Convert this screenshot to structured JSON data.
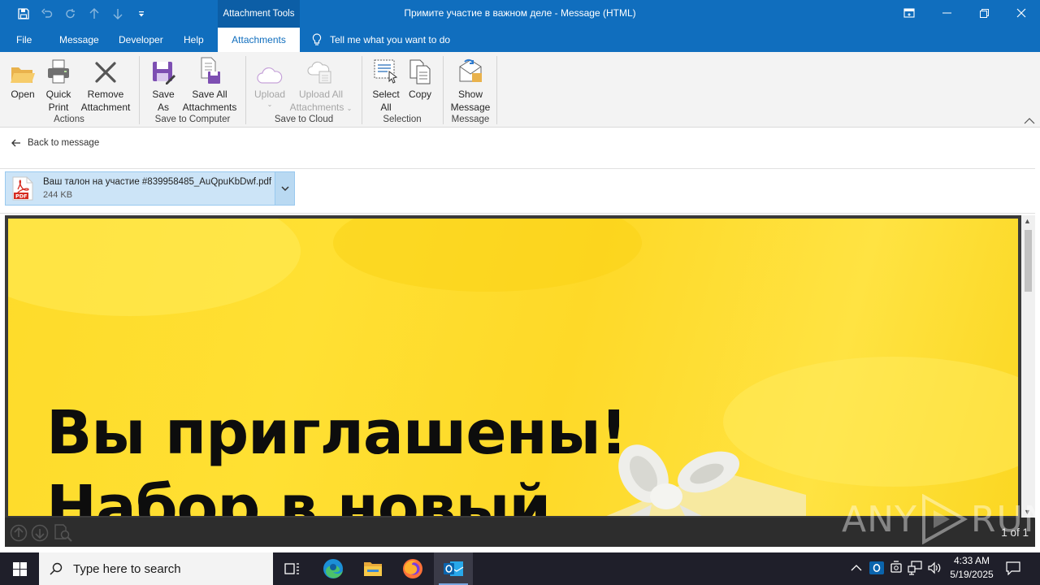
{
  "window": {
    "title": "Примите участие в важном деле  -  Message (HTML)",
    "contextual_tab": "Attachment Tools"
  },
  "tabs": [
    {
      "label": "File",
      "active": false
    },
    {
      "label": "Message",
      "active": false
    },
    {
      "label": "Developer",
      "active": false
    },
    {
      "label": "Help",
      "active": false
    },
    {
      "label": "Attachments",
      "active": true
    }
  ],
  "tell_me": "Tell me what you want to do",
  "ribbon": {
    "actions": {
      "label": "Actions",
      "open": "Open",
      "quick_print": [
        "Quick",
        "Print"
      ],
      "remove_attachment": [
        "Remove",
        "Attachment"
      ]
    },
    "save_to_computer": {
      "label": "Save to Computer",
      "save_as": [
        "Save",
        "As"
      ],
      "save_all": [
        "Save All",
        "Attachments"
      ]
    },
    "save_to_cloud": {
      "label": "Save to Cloud",
      "upload": "Upload",
      "upload_all": [
        "Upload All",
        "Attachments"
      ]
    },
    "selection": {
      "label": "Selection",
      "select_all": [
        "Select",
        "All"
      ],
      "copy": "Copy"
    },
    "message": {
      "label": "Message",
      "show_message": [
        "Show",
        "Message"
      ]
    }
  },
  "back_to_message": "Back to message",
  "attachment": {
    "name": "Ваш талон на участие #839958485_AuQpuKbDwf.pdf",
    "size": "244 KB",
    "type_badge": "PDF"
  },
  "preview": {
    "headline_line1": "Вы приглашены!",
    "headline_line2": "Набор в новый",
    "page_count": "1 of 1"
  },
  "watermark": {
    "left": "ANY",
    "right": "RUN"
  },
  "taskbar": {
    "search_placeholder": "Type here to search",
    "apps": [
      "task-view",
      "edge",
      "file-explorer",
      "firefox",
      "outlook"
    ],
    "time": "4:33 AM",
    "date": "5/19/2025"
  },
  "colors": {
    "accent": "#106ebe",
    "ribbon_bg": "#f3f3f3",
    "attachment_selected": "#cce4f7",
    "preview_yellow": "#fedb2a",
    "taskbar": "#1f1f2a"
  }
}
